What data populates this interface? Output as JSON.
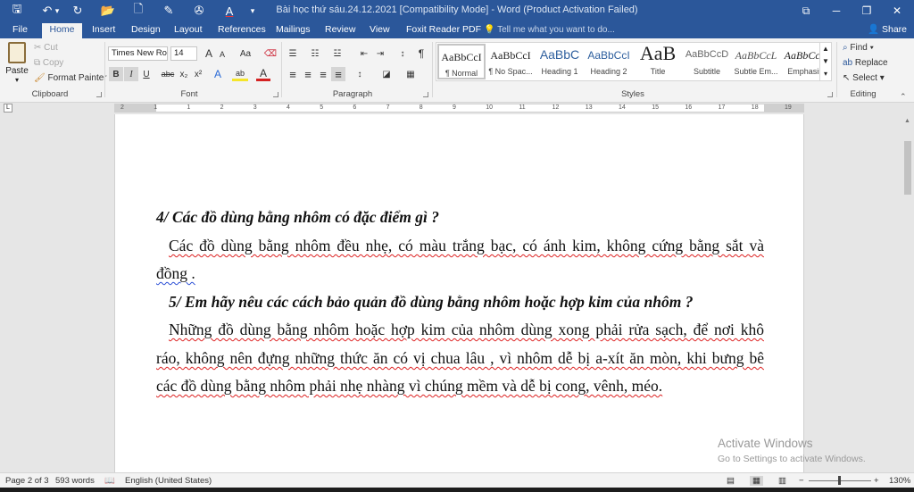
{
  "title_bar": {
    "title": "Bài học thứ sáu.24.12.2021 [Compatibility Mode] - Word (Product Activation Failed)",
    "quick_access": {
      "save": "🖫",
      "undo": "↶",
      "undo_dd": "▾",
      "redo": "↻",
      "open": "📂",
      "new": "🗋",
      "draw": "✎",
      "extra": "✇",
      "font_color": "A",
      "customize": "▾"
    },
    "window_controls": {
      "restore_ribbon": "⧉",
      "minimize": "─",
      "maximize": "❐",
      "close": "✕"
    }
  },
  "tabs": [
    "File",
    "Home",
    "Insert",
    "Design",
    "Layout",
    "References",
    "Mailings",
    "Review",
    "View",
    "Foxit Reader PDF"
  ],
  "tell_me": "Tell me what you want to do...",
  "share": "Share",
  "ribbon": {
    "clipboard": {
      "paste": "Paste",
      "cut": "Cut",
      "copy": "Copy",
      "format_painter": "Format Painter",
      "label": "Clipboard"
    },
    "font": {
      "font_name": "Times New Ro",
      "font_size": "14",
      "grow": "A",
      "shrink": "A",
      "case": "Aa",
      "clear": "⌫",
      "bold": "B",
      "italic": "I",
      "underline": "U",
      "strike": "abc",
      "sub": "x₂",
      "sup": "x²",
      "effects": "A",
      "highlight": "ab",
      "color": "A",
      "label": "Font"
    },
    "paragraph": {
      "bullets": "☰",
      "numbering": "☷",
      "multilevel": "☳",
      "dec_indent": "⇤",
      "inc_indent": "⇥",
      "sort": "↕",
      "pilcrow": "¶",
      "align_left": "≡",
      "center": "≡",
      "align_right": "≡",
      "justify": "≡",
      "spacing": "↕",
      "shading": "◪",
      "borders": "▦",
      "label": "Paragraph"
    },
    "styles": {
      "items": [
        {
          "preview": "AaBbCcI",
          "name": "¶ Normal"
        },
        {
          "preview": "AaBbCcI",
          "name": "¶ No Spac..."
        },
        {
          "preview": "AaBbC",
          "name": "Heading 1"
        },
        {
          "preview": "AaBbCcI",
          "name": "Heading 2"
        },
        {
          "preview": "AaB",
          "name": "Title"
        },
        {
          "preview": "AaBbCcD",
          "name": "Subtitle"
        },
        {
          "preview": "AaBbCcL",
          "name": "Subtle Em..."
        },
        {
          "preview": "AaBbCcL",
          "name": "Emphasis"
        }
      ],
      "label": "Styles"
    },
    "editing": {
      "find": "Find",
      "replace": "Replace",
      "select": "Select",
      "label": "Editing"
    }
  },
  "ruler": {
    "numbers": [
      "2",
      "1",
      "1",
      "2",
      "3",
      "4",
      "5",
      "6",
      "7",
      "8",
      "9",
      "10",
      "11",
      "12",
      "13",
      "14",
      "15",
      "16",
      "17",
      "18",
      "19"
    ]
  },
  "document": {
    "lines": [
      {
        "text": "4/  Các đồ dùng bằng nhôm có đặc điểm gì ?",
        "style": "bi"
      },
      {
        "text": "Các đồ dùng bằng nhôm đều nhẹ, có màu trắng bạc, có ánh kim, không cứng bằng sắt và",
        "style": "sq"
      },
      {
        "text": "đồng .",
        "style": "sq"
      },
      {
        "text": "5/ Em hãy nêu các cách bảo quản đồ dùng bằng nhôm hoặc hợp kim của nhôm ?",
        "style": "bi"
      },
      {
        "text": "Những đồ dùng bằng nhôm hoặc hợp kim của nhôm dùng xong phải rửa sạch, để nơi khô",
        "style": "sq"
      },
      {
        "text": "ráo, không nên đựng những thức ăn có vị chua lâu , vì nhôm dễ bị a-xít ăn mòn, khi bưng bê",
        "style": "sq"
      },
      {
        "text": "các đồ dùng bằng nhôm phải nhẹ nhàng vì chúng mềm và dễ bị cong, vênh, méo.",
        "style": "sq"
      }
    ]
  },
  "watermark": {
    "heading": "Activate Windows",
    "sub": "Go to Settings to activate Windows."
  },
  "status_bar": {
    "page": "Page 2 of 3",
    "words": "593 words",
    "proof": "📖",
    "language": "English (United States)",
    "zoom": "130%",
    "zoom_minus": "−",
    "zoom_plus": "+",
    "view_read": "▤",
    "view_print": "▦",
    "view_web": "▥"
  }
}
